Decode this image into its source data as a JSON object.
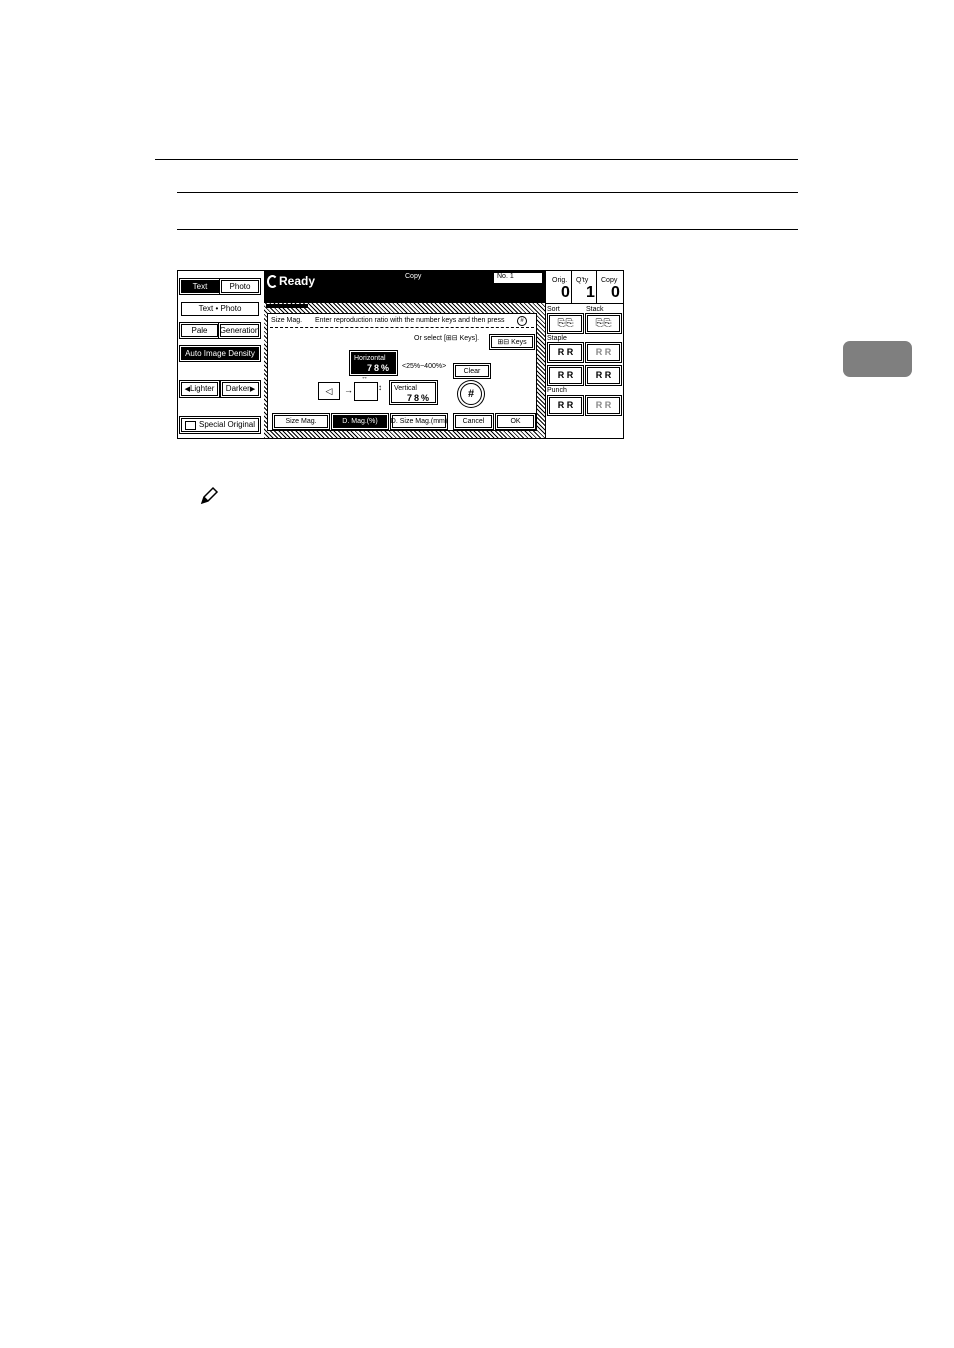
{
  "panel": {
    "left": {
      "text_label": "Text",
      "photo_label": "Photo",
      "text_photo_label": "Text • Photo",
      "pale_label": "Pale",
      "generation_label": "Generation",
      "auto_density_label": "Auto Image Density",
      "lighter_label": "Lighter",
      "darker_label": "Darker",
      "special_original_label": "Special Original"
    },
    "header": {
      "status": "Ready",
      "mode": "Copy",
      "number_label": "No. 1"
    },
    "counters": {
      "orig_label": "Orig.",
      "orig_value": "0",
      "qty_label": "Q'ty",
      "qty_value": "1",
      "copy_label": "Copy",
      "copy_value": "0"
    },
    "finisher": {
      "sort_label": "Sort",
      "stack_label": "Stack",
      "staple_label": "Staple",
      "punch_label": "Punch"
    },
    "dialog": {
      "title": "Size Mag.",
      "instruction": "Enter reproduction ratio with the number keys and then press",
      "or_select": "Or select [⊞⊟ Keys].",
      "keys_button": "Keys",
      "horizontal_label": "Horizontal",
      "horizontal_value": "78%",
      "range_text": "<25%~400%>",
      "clear_button": "Clear",
      "vertical_label": "Vertical",
      "vertical_value": "78%",
      "tabs": [
        "Size Mag.",
        "D. Mag.(%)",
        "D. Size Mag.(mm)"
      ],
      "cancel_button": "Cancel",
      "ok_button": "OK"
    }
  }
}
